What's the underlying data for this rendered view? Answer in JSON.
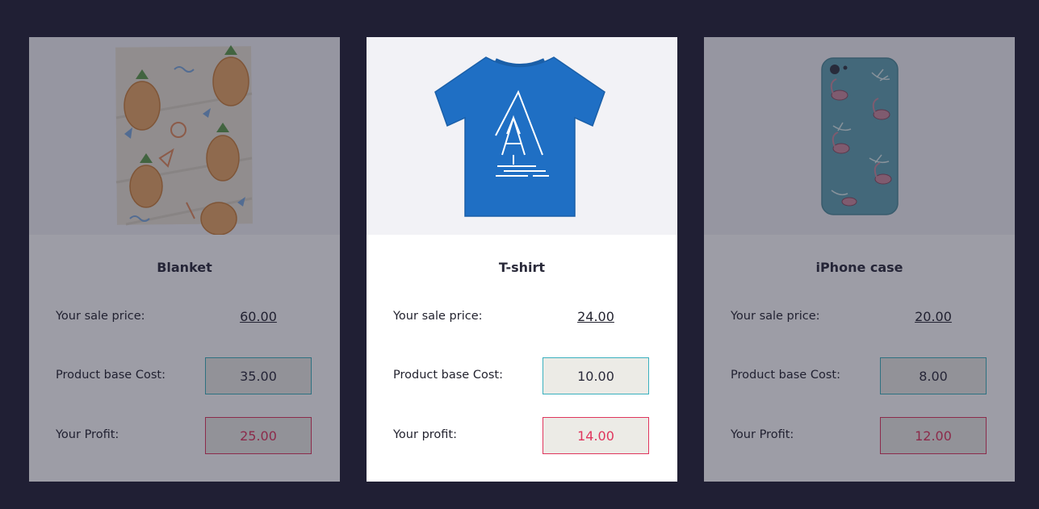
{
  "cards": [
    {
      "title": "Blanket",
      "sale_label": "Your sale price:",
      "sale_price": "60.00",
      "cost_label": "Product base Cost:",
      "base_cost": "35.00",
      "profit_label": "Your Profit:",
      "profit": "25.00",
      "image": "pineapple-blanket",
      "dimmed": true
    },
    {
      "title": "T-shirt",
      "sale_label": "Your sale price:",
      "sale_price": "24.00",
      "cost_label": "Product base Cost:",
      "base_cost": "10.00",
      "profit_label": "Your profit:",
      "profit": "14.00",
      "image": "blue-tshirt-tree",
      "dimmed": false
    },
    {
      "title": "iPhone case",
      "sale_label": "Your sale price:",
      "sale_price": "20.00",
      "cost_label": "Product base Cost:",
      "base_cost": "8.00",
      "profit_label": "Your Profit:",
      "profit": "12.00",
      "image": "flamingo-phone-case",
      "dimmed": true
    }
  ],
  "colors": {
    "background": "#201f34",
    "cost_border": "#3ab0be",
    "profit": "#e0355d",
    "field_fill": "#ecebe6"
  }
}
